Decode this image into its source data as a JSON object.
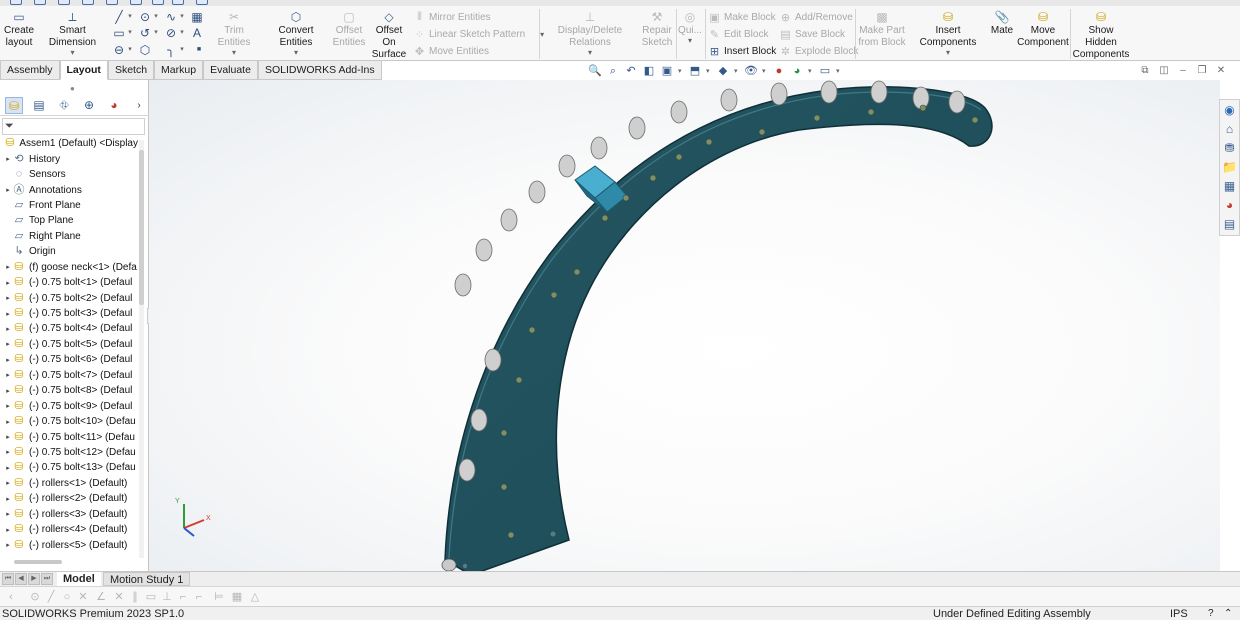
{
  "ribbon": {
    "create_layout": [
      "Create",
      "layout"
    ],
    "smart_dimension": "Smart Dimension",
    "trim_entities": "Trim Entities",
    "convert_entities": "Convert Entities",
    "offset_entities": [
      "Offset",
      "Entities"
    ],
    "offset_on_surface": [
      "Offset On",
      "Surface"
    ],
    "mirror_entities": "Mirror Entities",
    "linear_sketch_pattern": "Linear Sketch Pattern",
    "move_entities": "Move Entities",
    "display_delete_relations": "Display/Delete Relations",
    "repair_sketch": [
      "Repair",
      "Sketch"
    ],
    "quick_snaps": "Qui...",
    "make_block": "Make Block",
    "edit_block": "Edit Block",
    "insert_block": "Insert Block",
    "add_remove": "Add/Remove",
    "save_block": "Save Block",
    "explode_block": "Explode Block",
    "make_part_from_block": [
      "Make Part",
      "from Block"
    ],
    "insert_components": "Insert Components",
    "mate": "Mate",
    "move_component": [
      "Move",
      "Component"
    ],
    "show_hidden_components": [
      "Show Hidden",
      "Components"
    ]
  },
  "tabs": [
    "Assembly",
    "Layout",
    "Sketch",
    "Markup",
    "Evaluate",
    "SOLIDWORKS Add-Ins"
  ],
  "active_tab": "Layout",
  "tree": [
    {
      "label": "Assem1 (Default) <Display",
      "icon": "assembly-icon",
      "arrow": false,
      "indent": 0
    },
    {
      "label": "History",
      "icon": "history-icon",
      "arrow": true,
      "indent": 1
    },
    {
      "label": "Sensors",
      "icon": "sensors-icon",
      "arrow": false,
      "indent": 1
    },
    {
      "label": "Annotations",
      "icon": "annotations-icon",
      "arrow": true,
      "indent": 1
    },
    {
      "label": "Front Plane",
      "icon": "plane-icon",
      "arrow": false,
      "indent": 1
    },
    {
      "label": "Top Plane",
      "icon": "plane-icon",
      "arrow": false,
      "indent": 1
    },
    {
      "label": "Right Plane",
      "icon": "plane-icon",
      "arrow": false,
      "indent": 1
    },
    {
      "label": "Origin",
      "icon": "origin-icon",
      "arrow": false,
      "indent": 1
    },
    {
      "label": "(f) goose neck<1> (Defa",
      "icon": "part-icon",
      "arrow": true,
      "indent": 1
    },
    {
      "label": "(-) 0.75 bolt<1> (Defaul",
      "icon": "part-icon",
      "arrow": true,
      "indent": 1
    },
    {
      "label": "(-) 0.75 bolt<2> (Defaul",
      "icon": "part-icon",
      "arrow": true,
      "indent": 1
    },
    {
      "label": "(-) 0.75 bolt<3> (Defaul",
      "icon": "part-icon",
      "arrow": true,
      "indent": 1
    },
    {
      "label": "(-) 0.75 bolt<4> (Defaul",
      "icon": "part-icon",
      "arrow": true,
      "indent": 1
    },
    {
      "label": "(-) 0.75 bolt<5> (Defaul",
      "icon": "part-icon",
      "arrow": true,
      "indent": 1
    },
    {
      "label": "(-) 0.75 bolt<6> (Defaul",
      "icon": "part-icon",
      "arrow": true,
      "indent": 1
    },
    {
      "label": "(-) 0.75 bolt<7> (Defaul",
      "icon": "part-icon",
      "arrow": true,
      "indent": 1
    },
    {
      "label": "(-) 0.75 bolt<8> (Defaul",
      "icon": "part-icon",
      "arrow": true,
      "indent": 1
    },
    {
      "label": "(-) 0.75 bolt<9> (Defaul",
      "icon": "part-icon",
      "arrow": true,
      "indent": 1
    },
    {
      "label": "(-) 0.75 bolt<10> (Defau",
      "icon": "part-icon",
      "arrow": true,
      "indent": 1
    },
    {
      "label": "(-) 0.75 bolt<11> (Defau",
      "icon": "part-icon",
      "arrow": true,
      "indent": 1
    },
    {
      "label": "(-) 0.75 bolt<12> (Defau",
      "icon": "part-icon",
      "arrow": true,
      "indent": 1
    },
    {
      "label": "(-) 0.75 bolt<13> (Defau",
      "icon": "part-icon",
      "arrow": true,
      "indent": 1
    },
    {
      "label": "(-) rollers<1> (Default)",
      "icon": "part-icon",
      "arrow": true,
      "indent": 1
    },
    {
      "label": "(-) rollers<2> (Default)",
      "icon": "part-icon",
      "arrow": true,
      "indent": 1
    },
    {
      "label": "(-) rollers<3> (Default)",
      "icon": "part-icon",
      "arrow": true,
      "indent": 1
    },
    {
      "label": "(-) rollers<4> (Default)",
      "icon": "part-icon",
      "arrow": true,
      "indent": 1
    },
    {
      "label": "(-) rollers<5> (Default)",
      "icon": "part-icon",
      "arrow": true,
      "indent": 1
    }
  ],
  "model_tabs": [
    "Model",
    "Motion Study 1"
  ],
  "active_model_tab": "Model",
  "triad": {
    "x": "X",
    "y": "Y"
  },
  "status": {
    "product": "SOLIDWORKS Premium 2023 SP1.0",
    "definition": "Under Defined",
    "mode": "Editing Assembly",
    "units": "IPS"
  },
  "colors": {
    "model_body": "#1f4f5a",
    "model_edge": "#153c45",
    "roller": "#c9c9c9",
    "mount_block": "#3d9dbd",
    "accent": "#3d5f8f"
  }
}
